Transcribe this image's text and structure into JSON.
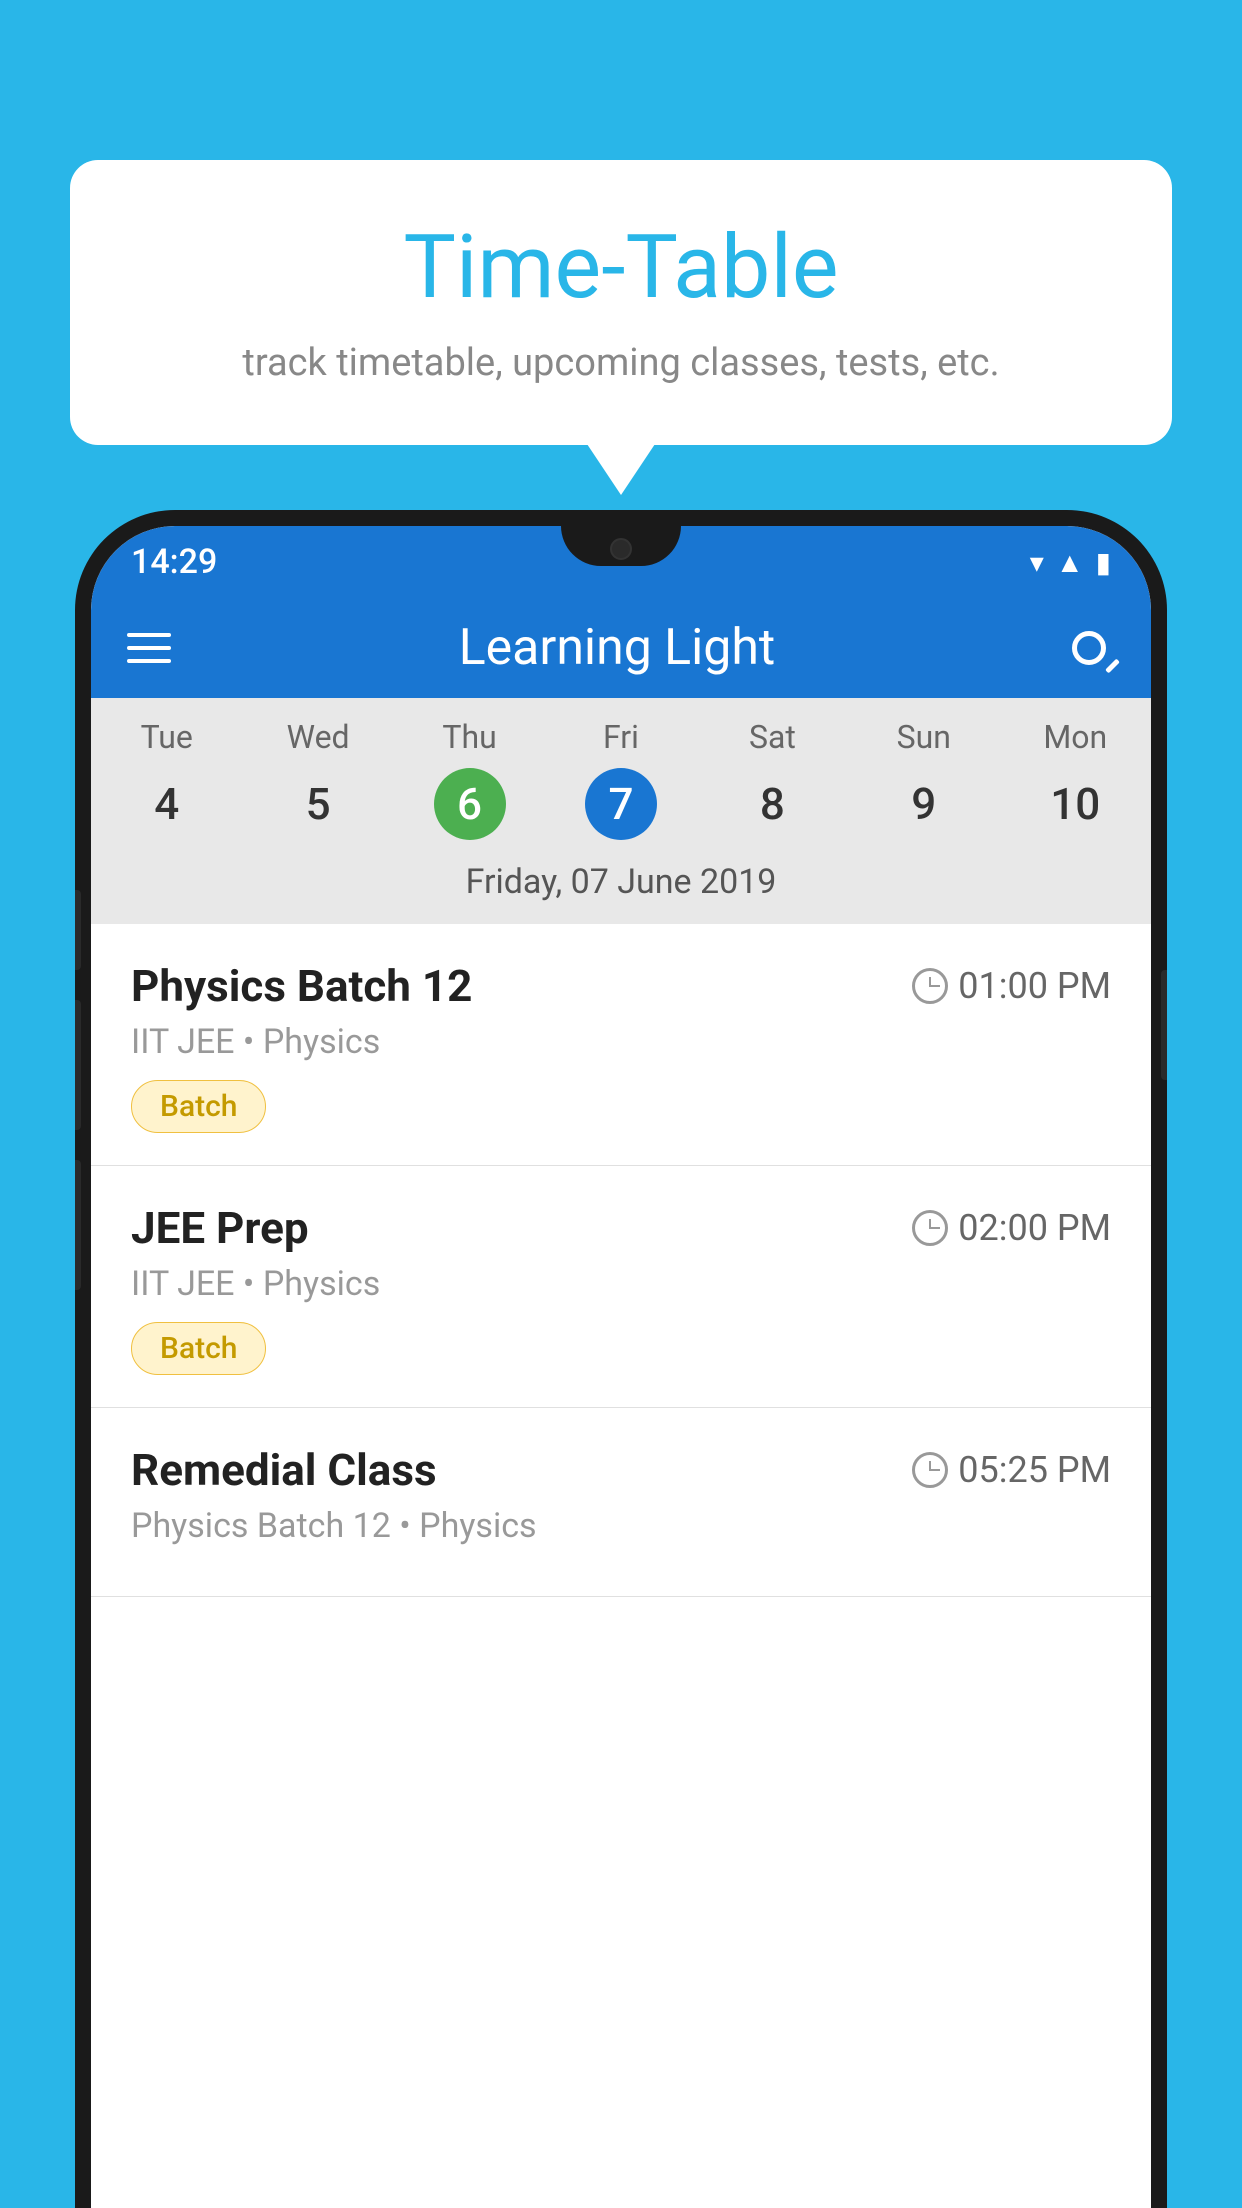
{
  "background_color": "#29b6e8",
  "speech_bubble": {
    "title": "Time-Table",
    "subtitle": "track timetable, upcoming classes, tests, etc."
  },
  "status_bar": {
    "time": "14:29"
  },
  "app_bar": {
    "title": "Learning Light"
  },
  "calendar": {
    "days": [
      {
        "label": "Tue",
        "number": "4",
        "state": "normal"
      },
      {
        "label": "Wed",
        "number": "5",
        "state": "normal"
      },
      {
        "label": "Thu",
        "number": "6",
        "state": "today"
      },
      {
        "label": "Fri",
        "number": "7",
        "state": "selected"
      },
      {
        "label": "Sat",
        "number": "8",
        "state": "normal"
      },
      {
        "label": "Sun",
        "number": "9",
        "state": "normal"
      },
      {
        "label": "Mon",
        "number": "10",
        "state": "normal"
      }
    ],
    "selected_date_label": "Friday, 07 June 2019"
  },
  "schedule": [
    {
      "title": "Physics Batch 12",
      "time": "01:00 PM",
      "subtitle": "IIT JEE • Physics",
      "badge": "Batch"
    },
    {
      "title": "JEE Prep",
      "time": "02:00 PM",
      "subtitle": "IIT JEE • Physics",
      "badge": "Batch"
    },
    {
      "title": "Remedial Class",
      "time": "05:25 PM",
      "subtitle": "Physics Batch 12 • Physics",
      "badge": null
    }
  ],
  "icons": {
    "hamburger": "menu-icon",
    "search": "search-icon"
  }
}
